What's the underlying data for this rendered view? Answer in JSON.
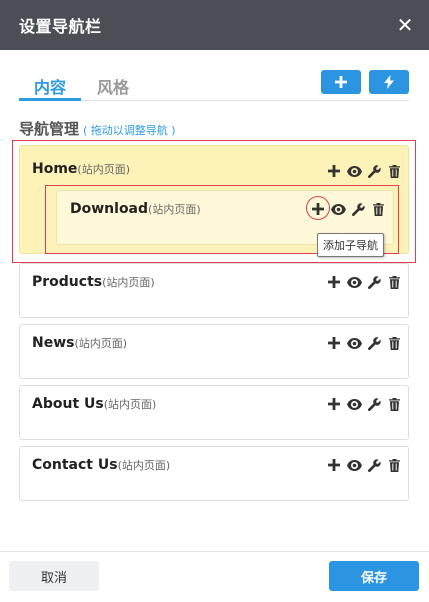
{
  "dialog": {
    "title": "设置导航栏",
    "close_icon": "close-icon"
  },
  "tabs": [
    {
      "label": "内容",
      "active": true
    },
    {
      "label": "风格",
      "active": false
    }
  ],
  "toolbar": {
    "add_icon": "plus-icon",
    "quick_icon": "lightning-icon"
  },
  "section": {
    "heading": "导航管理",
    "hint": "( 拖动以调整导航 )"
  },
  "nav_items": [
    {
      "name": "Home",
      "type": "(站内页面)",
      "highlighted": true
    },
    {
      "name": "Download",
      "type": "(站内页面)",
      "child_of": "Home"
    },
    {
      "name": "Products",
      "type": "(站内页面)"
    },
    {
      "name": "News",
      "type": "(站内页面)"
    },
    {
      "name": "About Us",
      "type": "(站内页面)"
    },
    {
      "name": "Contact Us",
      "type": "(站内页面)"
    }
  ],
  "actions": [
    "plus-icon",
    "eye-icon",
    "wrench-icon",
    "trash-icon"
  ],
  "tooltip": {
    "text": "添加子导航"
  },
  "footer": {
    "cancel_label": "取消",
    "save_label": "保存"
  },
  "colors": {
    "header_bg": "#4b4e55",
    "accent": "#2b95e2",
    "highlight_bg": "#fdf3b8",
    "sub_bg": "#fff9d9",
    "annotation_red": "#e03f4f"
  }
}
